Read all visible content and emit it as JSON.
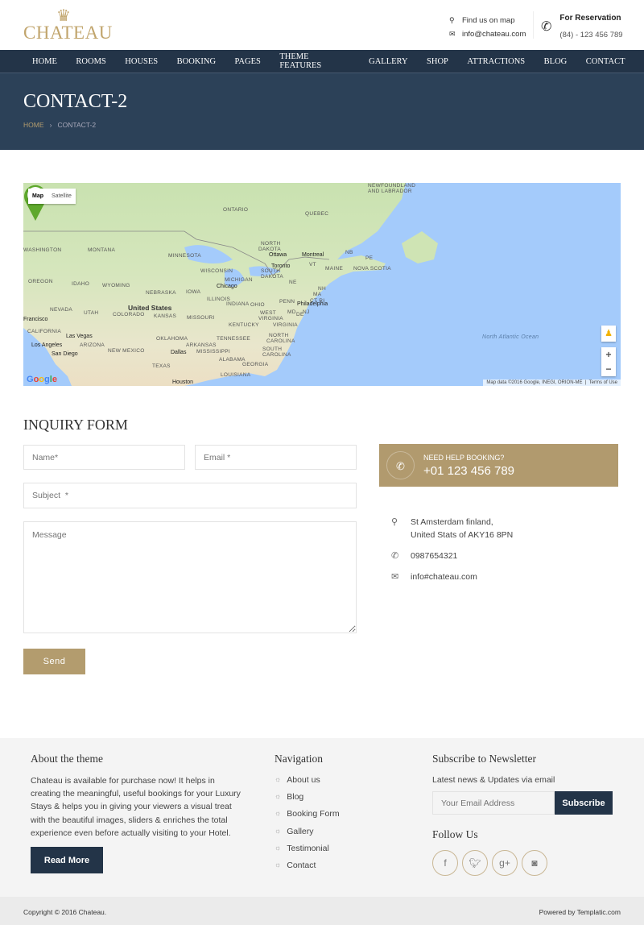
{
  "brand": {
    "name": "CHATEAU",
    "crown_icon": "crown-icon"
  },
  "header": {
    "find_map": "Find us on map",
    "email": "info@chateau.com",
    "reservation_label": "For Reservation",
    "reservation_phone": "(84) - 123 456 789"
  },
  "nav": [
    "HOME",
    "ROOMS",
    "HOUSES",
    "BOOKING",
    "PAGES",
    "THEME FEATURES",
    "GALLERY",
    "SHOP",
    "ATTRACTIONS",
    "BLOG",
    "CONTACT"
  ],
  "banner": {
    "title": "CONTACT-2",
    "breadcrumb": {
      "home": "HOME",
      "sep": "›",
      "current": "CONTACT-2"
    }
  },
  "map": {
    "type_map": "Map",
    "type_satellite": "Satellite",
    "zoom_in": "+",
    "zoom_out": "−",
    "attribution": "Map data ©2016 Google, INEGI, ORION-ME",
    "terms": "Terms of Use",
    "google": "Google",
    "labels": [
      "NEWFOUNDLAND",
      "AND LABRADOR",
      "ONTARIO",
      "QUEBEC",
      "NORTH",
      "DAKOTA",
      "MONTANA",
      "WASHINGTON",
      "MINNESOTA",
      "SOUTH",
      "DAKOTA",
      "WISCONSIN",
      "MICHIGAN",
      "OREGON",
      "IDAHO",
      "WYOMING",
      "NEBRASKA",
      "IOWA",
      "ILLINOIS",
      "INDIANA",
      "OHIO",
      "PENN",
      "NEVADA",
      "UTAH",
      "COLORADO",
      "KANSAS",
      "MISSOURI",
      "WEST",
      "VIRGINIA",
      "KENTUCKY",
      "VIRGINIA",
      "CALIFORNIA",
      "OKLAHOMA",
      "TENNESSEE",
      "NORTH",
      "CAROLINA",
      "ARIZONA",
      "NEW MEXICO",
      "ARKANSAS",
      "MISSISSIPPI",
      "SOUTH",
      "CAROLINA",
      "ALABAMA",
      "GEORGIA",
      "TEXAS",
      "LOUISIANA",
      "MAINE",
      "NOVA SCOTIA",
      "NB",
      "PE",
      "VT",
      "NH",
      "MA",
      "CT RI",
      "NE",
      "MD",
      "DE",
      "NJ"
    ],
    "cities": [
      "Ottawa",
      "Montreal",
      "Toronto",
      "Chicago",
      "Philadelphia",
      "Francisco",
      "Las Vegas",
      "Los Angeles",
      "San Diego",
      "Dallas",
      "Houston"
    ],
    "country": "United States",
    "ocean": "North Atlantic Ocean"
  },
  "form": {
    "title": "INQUIRY FORM",
    "name_placeholder": "Name*",
    "email_placeholder": "Email *",
    "subject_placeholder": "Subject  *",
    "message_placeholder": "Message",
    "send": "Send"
  },
  "help": {
    "label": "NEED HELP BOOKING?",
    "phone": "+01 123 456 789"
  },
  "contact": {
    "address1": "St Amsterdam finland,",
    "address2": "United Stats of AKY16 8PN",
    "phone": "0987654321",
    "email": "info#chateau.com"
  },
  "footer": {
    "about_title": "About the theme",
    "about_text": "Chateau is available for purchase now! It helps in creating the meaningful, useful bookings for your Luxury Stays & helps you in giving your viewers a visual treat with the beautiful images, sliders & enriches the total experience even before actually visiting to your Hotel.",
    "read_more": "Read More",
    "nav_title": "Navigation",
    "nav_items": [
      "About us",
      "Blog",
      "Booking Form",
      "Gallery",
      "Testimonial",
      "Contact"
    ],
    "subscribe_title": "Subscribe to Newsletter",
    "subscribe_text": "Latest news & Updates via email",
    "email_placeholder": "Your Email Address",
    "subscribe_button": "Subscribe",
    "follow_title": "Follow Us",
    "social": [
      "facebook",
      "twitter",
      "google-plus",
      "instagram"
    ],
    "copyright": "Copyright © 2016 Chateau.",
    "powered": "Powered by Templatic.com"
  },
  "colors": {
    "navy": "#233448",
    "banner": "#2c4158",
    "gold": "#b39c6e"
  }
}
